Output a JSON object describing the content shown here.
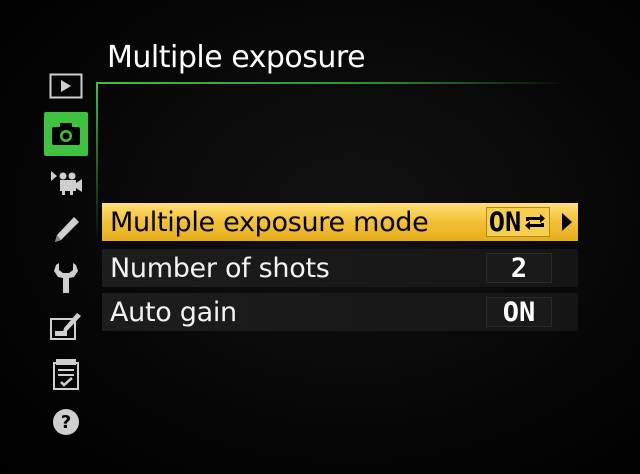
{
  "title": "Multiple exposure",
  "rail": [
    {
      "name": "playback-menu-icon",
      "active": false
    },
    {
      "name": "photo-shooting-menu-icon",
      "active": true
    },
    {
      "name": "movie-shooting-menu-icon",
      "active": false
    },
    {
      "name": "custom-settings-pencil-icon",
      "active": false
    },
    {
      "name": "setup-menu-wrench-icon",
      "active": false
    },
    {
      "name": "retouch-menu-icon",
      "active": false
    },
    {
      "name": "my-menu-icon",
      "active": false
    },
    {
      "name": "help-question-icon",
      "active": false
    }
  ],
  "menu": {
    "items": [
      {
        "label": "Multiple exposure mode",
        "value": "ON",
        "value_icon": "series-repeat-icon",
        "selected": true
      },
      {
        "label": "Number of shots",
        "value": "2",
        "selected": false
      },
      {
        "label": "Auto gain",
        "value": "ON",
        "selected": false
      }
    ]
  },
  "colors": {
    "accent_green": "#3fc23f",
    "selection_yellow": "#f4c33a",
    "background": "#000000"
  }
}
